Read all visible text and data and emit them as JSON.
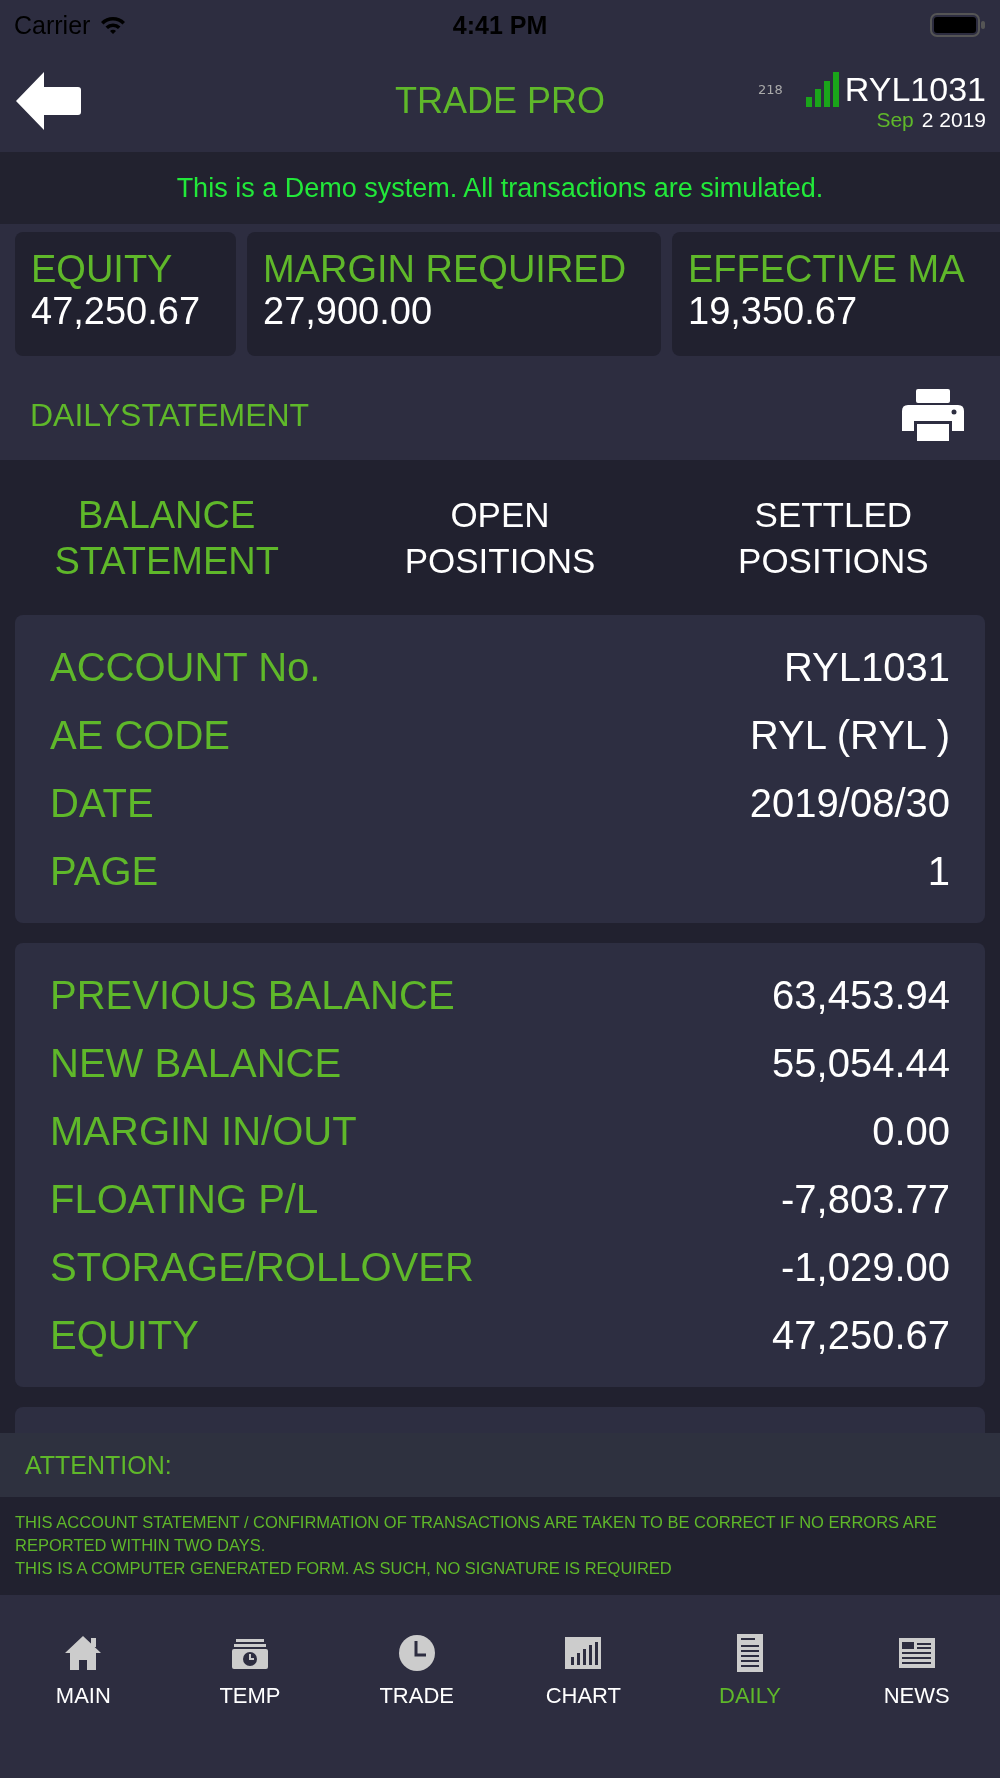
{
  "status_bar": {
    "carrier": "Carrier",
    "time": "4:41 PM"
  },
  "nav": {
    "title": "TRADE PRO",
    "count": "218",
    "account": "RYL1031",
    "date_month": "Sep",
    "date_rest": "2 2019"
  },
  "banner": "This is a Demo system. All transactions are simulated.",
  "metrics": [
    {
      "label": "EQUITY",
      "value": "47,250.67"
    },
    {
      "label": "MARGIN REQUIRED",
      "value": "27,900.00"
    },
    {
      "label": "EFFECTIVE MA",
      "value": "19,350.67"
    }
  ],
  "section_title": "DAILYSTATEMENT",
  "tabs": [
    {
      "label": "BALANCE\nSTATEMENT",
      "selected": true
    },
    {
      "label": "OPEN\nPOSITIONS",
      "selected": false
    },
    {
      "label": "SETTLED\nPOSITIONS",
      "selected": false
    }
  ],
  "cards": [
    {
      "rows": [
        {
          "label": "ACCOUNT No.",
          "value": "RYL1031"
        },
        {
          "label": "AE CODE",
          "value": "RYL (RYL )"
        },
        {
          "label": "DATE",
          "value": "2019/08/30"
        },
        {
          "label": "PAGE",
          "value": "1"
        }
      ]
    },
    {
      "rows": [
        {
          "label": "PREVIOUS BALANCE",
          "value": "63,453.94"
        },
        {
          "label": "NEW BALANCE",
          "value": "55,054.44"
        },
        {
          "label": "MARGIN IN/OUT",
          "value": "0.00"
        },
        {
          "label": "FLOATING P/L",
          "value": "-7,803.77"
        },
        {
          "label": "STORAGE/ROLLOVER",
          "value": "-1,029.00"
        },
        {
          "label": "EQUITY",
          "value": "47,250.67"
        }
      ]
    }
  ],
  "attention": {
    "title": "ATTENTION:",
    "lines": [
      "THIS ACCOUNT STATEMENT / CONFIRMATION OF TRANSACTIONS ARE TAKEN TO BE CORRECT IF NO ERRORS ARE REPORTED WITHIN TWO DAYS.",
      "THIS IS A COMPUTER GENERATED FORM. AS SUCH, NO SIGNATURE IS REQUIRED"
    ]
  },
  "tab_bar": [
    {
      "label": "MAIN",
      "selected": false
    },
    {
      "label": "TEMP",
      "selected": false
    },
    {
      "label": "TRADE",
      "selected": false
    },
    {
      "label": "CHART",
      "selected": false
    },
    {
      "label": "DAILY",
      "selected": true
    },
    {
      "label": "NEWS",
      "selected": false
    }
  ]
}
